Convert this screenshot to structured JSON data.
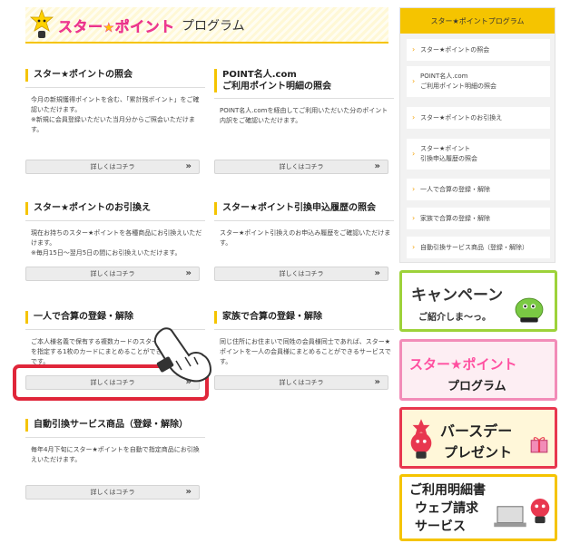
{
  "header": {
    "logo_text": "スター",
    "logo_text2": "ポイント",
    "program_text": "プログラム"
  },
  "boxes": [
    {
      "title": "スター★ポイントの照会",
      "desc": "今月の新規獲得ポイントを含む、「累計残ポイント」をご確認いただけます。",
      "note": "※新規に会員登録いただいた当月分からご照会いただけます。",
      "button": "詳しくはコチラ"
    },
    {
      "title": "POINT名人.com",
      "title2": "ご利用ポイント明細の照会",
      "desc": "POINT名人.comを経由してご利用いただいた分のポイント内訳をご確認いただけます。",
      "button": "詳しくはコチラ"
    },
    {
      "title": "スター★ポイントのお引換え",
      "desc": "現在お持ちのスター★ポイントを各種商品にお引換えいただけます。",
      "note": "※毎月15日～翌月5日の間にお引換えいただけます。",
      "button": "詳しくはコチラ"
    },
    {
      "title": "スター★ポイント引換申込履歴の照会",
      "desc": "スター★ポイント引換えのお申込み履歴をご確認いただけます。",
      "button": "詳しくはコチラ"
    },
    {
      "title": "一人で合算の登録・解除",
      "desc": "ご本人様名義で保有する複数カードのスター",
      "desc2": "を指定する1枚のカードにまとめることができ",
      "desc3": "です。",
      "button": "詳しくはコチラ"
    },
    {
      "title": "家族で合算の登録・解除",
      "desc": "同じ住所にお住まいで同姓の会員様同士であれば、スター★ポイントを一人の会員様にまとめることができるサービスです。",
      "button": "詳しくはコチラ"
    },
    {
      "title": "自動引換サービス商品（登録・解除）",
      "desc": "毎年4月下旬にスター★ポイントを自動で指定商品にお引換えいただけます。",
      "button": "詳しくはコチラ"
    }
  ],
  "sidebar": {
    "header": "スター★ポイントプログラム",
    "items": [
      {
        "line1": "スター★ポイントの照会",
        "line2": ""
      },
      {
        "line1": "POINT名人.com",
        "line2": "ご利用ポイント明細の照会"
      },
      {
        "line1": "スター★ポイントのお引換え",
        "line2": ""
      },
      {
        "line1": "スター★ポイント",
        "line2": "引換申込履歴の照会"
      },
      {
        "line1": "一人で合算の登録・解除",
        "line2": ""
      },
      {
        "line1": "家族で合算の登録・解除",
        "line2": ""
      },
      {
        "line1": "自動引換サービス商品（登録・解除）",
        "line2": ""
      }
    ]
  },
  "banners": {
    "campaign_line1": "キャンペーン",
    "campaign_line2": "ご紹介しま〜っ。",
    "program_line1": "スター★ポイント",
    "program_line2": "プログラム",
    "birthday_line1": "バースデー",
    "birthday_line2": "プレゼント",
    "web_line1": "ご利用明細書",
    "web_line2": "ウェブ請求",
    "web_line3": "サービス"
  },
  "colors": {
    "accent": "#f5c400",
    "highlight": "#e0263a",
    "logo_pink": "#ff4fa0"
  },
  "icons": {
    "chevron": "chevron-double-right-icon",
    "arrow": "arrow-right-icon",
    "hand": "hand-pointer-icon"
  }
}
